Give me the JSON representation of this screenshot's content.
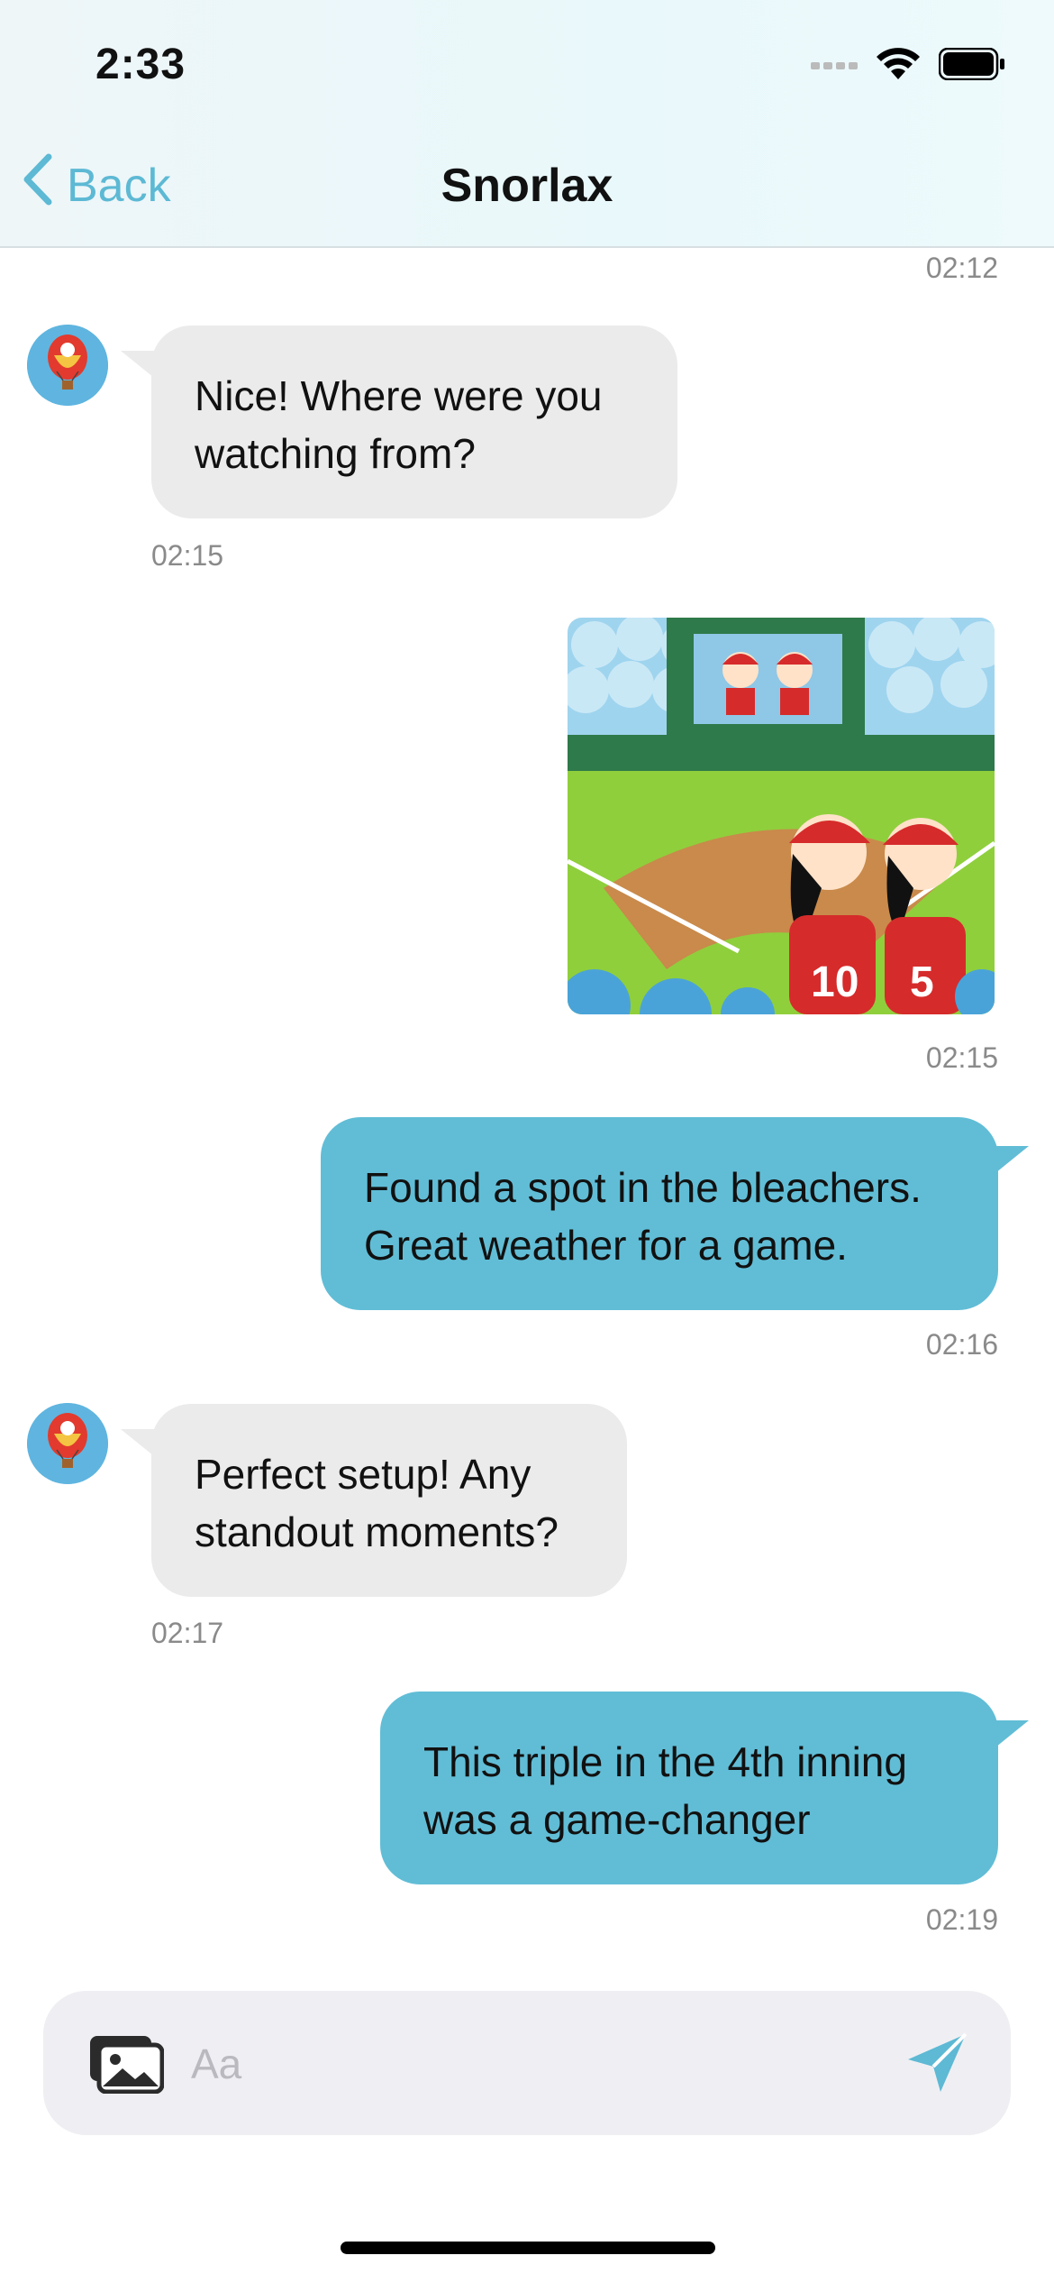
{
  "status_bar": {
    "time": "2:33"
  },
  "nav": {
    "back_label": "Back",
    "title": "Snorlax"
  },
  "messages": [
    {
      "type": "timestamp",
      "time": "02:12"
    },
    {
      "type": "incoming",
      "text": "Nice! Where were you watching from?",
      "time": "02:15"
    },
    {
      "type": "outgoing-image",
      "icon": "baseball-stadium-fans-image",
      "time": "02:15"
    },
    {
      "type": "outgoing",
      "text": "Found a spot in the bleachers. Great weather for a game.",
      "time": "02:16"
    },
    {
      "type": "incoming",
      "text": "Perfect setup! Any standout moments?",
      "time": "02:17"
    },
    {
      "type": "outgoing",
      "text": "This triple in the 4th inning was a game-changer",
      "time": "02:19"
    }
  ],
  "composer": {
    "placeholder": "Aa"
  },
  "colors": {
    "accent": "#5DB9D4",
    "outgoing_bubble": "#61BDD6",
    "incoming_bubble": "#EBEBEB"
  },
  "icons": {
    "back": "chevron-left-icon",
    "gallery": "photo-gallery-icon",
    "send": "paper-plane-icon",
    "avatar": "hot-air-balloon-avatar"
  }
}
